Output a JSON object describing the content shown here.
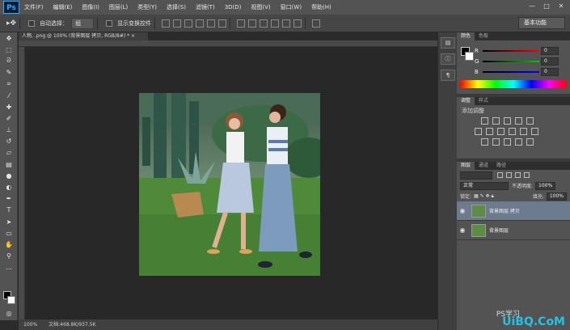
{
  "app": {
    "logo": "Ps"
  },
  "menu": [
    "文件(F)",
    "编辑(E)",
    "图像(I)",
    "图层(L)",
    "类型(Y)",
    "选择(S)",
    "滤镜(T)",
    "3D(D)",
    "视图(V)",
    "窗口(W)",
    "帮助(H)"
  ],
  "window_controls": {
    "minimize": "—",
    "maximize": "□",
    "close": "✕"
  },
  "options": {
    "auto_select_label": "自动选择：",
    "auto_select_value": "组",
    "show_transform_label": "显示变换控件",
    "workspace": "基本功能"
  },
  "document": {
    "tab_title": "人物, .png @ 100% (背景图层 拷贝, RGB/8#) *  ×",
    "zoom": "100%",
    "doc_info": "文档:468.8K/937.5K"
  },
  "color_panel": {
    "tabs": [
      "颜色",
      "色板"
    ],
    "sliders": [
      {
        "label": "R",
        "value": "0",
        "color": "#e02020"
      },
      {
        "label": "G",
        "value": "0",
        "color": "#20b020"
      },
      {
        "label": "B",
        "value": "0",
        "color": "#2040e0"
      }
    ]
  },
  "adjust_panel": {
    "tabs": [
      "调整",
      "样式"
    ],
    "add_label": "添加调整"
  },
  "layers_panel": {
    "tabs": [
      "图层",
      "通道",
      "路径"
    ],
    "blend_mode": "正常",
    "opacity_label": "不透明度:",
    "opacity": "100%",
    "lock_label": "锁定:",
    "fill_label": "填充:",
    "fill": "100%",
    "layers": [
      {
        "name": "背景图层 拷贝",
        "selected": true
      },
      {
        "name": "背景图层",
        "selected": false
      }
    ]
  },
  "watermark": {
    "brand": "UiBQ.CoM",
    "sub": "PS学习"
  },
  "colors": {
    "accent": "#31a8ff",
    "panel": "#535353",
    "canvas": "#282828"
  }
}
